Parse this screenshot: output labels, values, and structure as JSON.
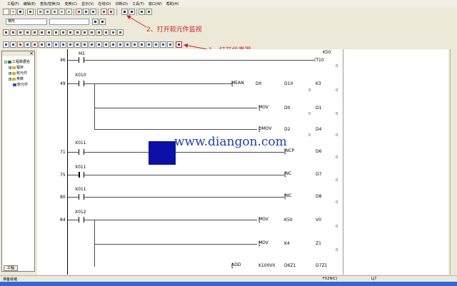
{
  "menu": [
    "工程(F)",
    "编辑(E)",
    "查找/替换(S)",
    "变换(C)",
    "显示(V)",
    "在线(O)",
    "诊断(D)",
    "工具(T)",
    "窗口(W)",
    "帮助(H)"
  ],
  "toolbar2": {
    "combo1": "梯形",
    "combo2": ""
  },
  "left_panel": {
    "items": [
      "工程数据名",
      "程序",
      "软元件",
      "参数",
      "软元件"
    ],
    "tab": "工程"
  },
  "ladder": {
    "rungs": [
      {
        "step": "46",
        "contact": "M1",
        "coil": "T10",
        "value": "K50",
        "z": "0"
      },
      {
        "step": "49",
        "contact": "X010"
      },
      {
        "step": "71",
        "contact": "X011"
      },
      {
        "step": "75",
        "contact": "X011"
      },
      {
        "step": "80",
        "contact": "X011"
      },
      {
        "step": "84",
        "contact": "X012"
      }
    ],
    "instr": {
      "mean": [
        "MEAN",
        "D0",
        "D10",
        "K3"
      ],
      "mov1": [
        "MOV",
        "D0",
        "D1"
      ],
      "dmov": [
        "DMOV",
        "D2",
        "D4"
      ],
      "incp": [
        "INCP",
        "D6"
      ],
      "inc1": [
        "INC",
        "D7"
      ],
      "inc2": [
        "INC",
        "D8"
      ],
      "mov2": [
        "MOV",
        "K50",
        "V0"
      ],
      "mov3": [
        "MOV",
        "K4",
        "Z1"
      ],
      "add": [
        "ADD",
        "K100V0",
        "D6Z1",
        "D7Z1"
      ]
    },
    "zero": "0"
  },
  "annotations": {
    "a1": "1、打开仿真器",
    "a2": "2、打开软元件监视"
  },
  "watermark": "www.diangon.com",
  "status": {
    "left": "准备就绪",
    "mid": "FX2N(C)",
    "right": "LJ7"
  },
  "colors": {
    "accent": "#d02020",
    "watermark": "#1c3fb0",
    "box": "#0b10a6"
  }
}
